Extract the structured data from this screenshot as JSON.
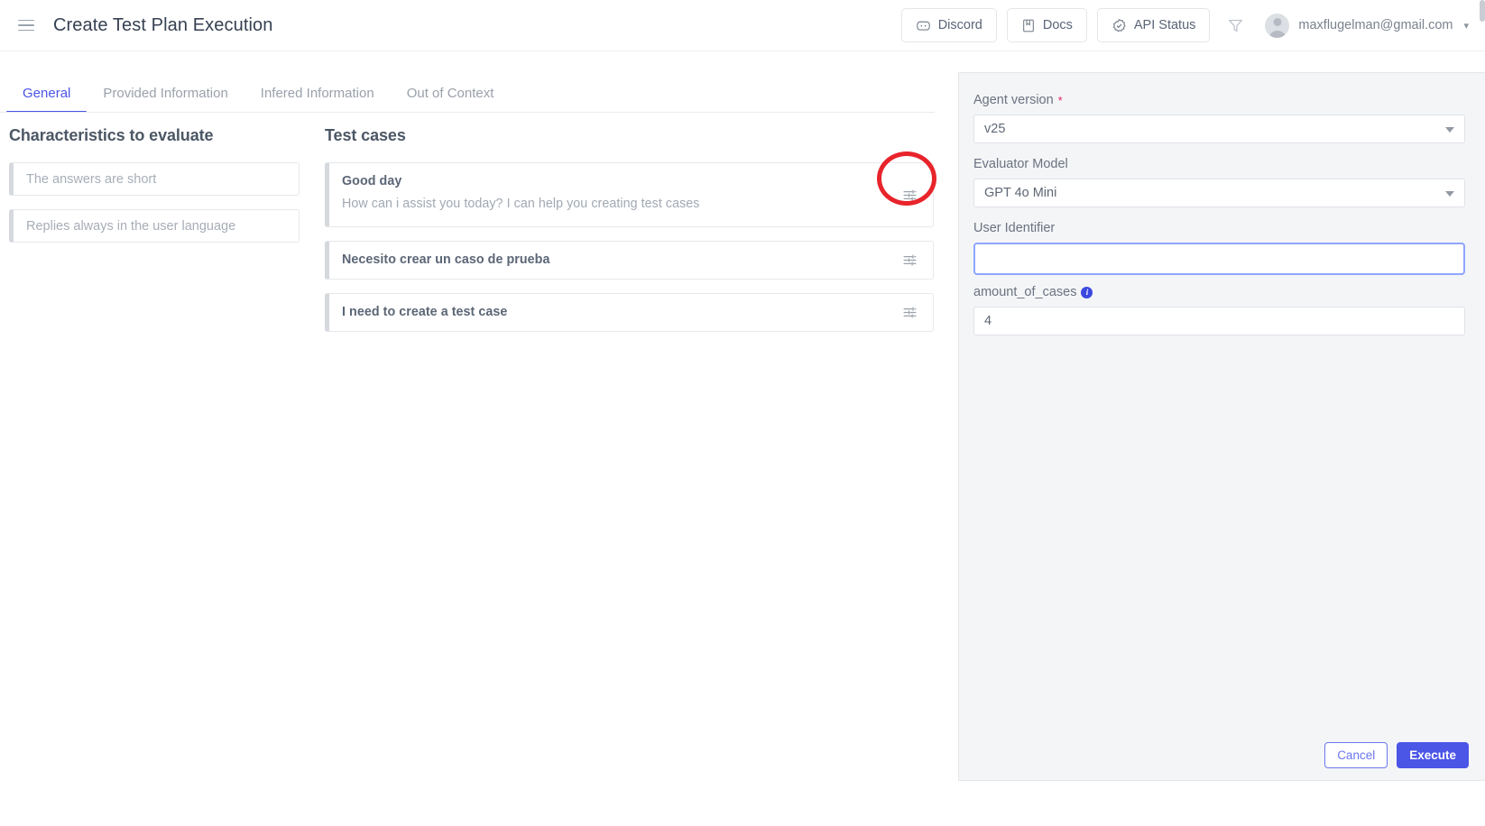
{
  "topbar": {
    "menu_icon": "hamburger-icon",
    "title": "Create Test Plan Execution",
    "buttons": [
      {
        "label": "Discord",
        "icon": "discord-icon"
      },
      {
        "label": "Docs",
        "icon": "book-icon"
      },
      {
        "label": "API Status",
        "icon": "check-badge-icon"
      }
    ],
    "filter_icon": "filter-icon",
    "user": {
      "email": "maxflugelman@gmail.com",
      "avatar_icon": "avatar-icon",
      "caret_icon": "chevron-down-icon"
    }
  },
  "tabs": [
    {
      "label": "General",
      "active": true
    },
    {
      "label": "Provided Information",
      "active": false
    },
    {
      "label": "Infered Information",
      "active": false
    },
    {
      "label": "Out of Context",
      "active": false
    }
  ],
  "characteristics": {
    "heading": "Characteristics to evaluate",
    "items": [
      {
        "text": "The answers are short"
      },
      {
        "text": "Replies always in the user language"
      }
    ]
  },
  "test_cases": {
    "heading": "Test cases",
    "items": [
      {
        "title": "Good day",
        "subtitle": "How can i assist you today? I can help you creating test cases",
        "action_icon": "tune-icon",
        "highlighted": true
      },
      {
        "title": "Necesito crear un caso de prueba",
        "subtitle": "",
        "action_icon": "tune-icon",
        "highlighted": false
      },
      {
        "title": "I need to create a test case",
        "subtitle": "",
        "action_icon": "tune-icon",
        "highlighted": false
      }
    ]
  },
  "right_panel": {
    "agent_version": {
      "label": "Agent version",
      "required_marker": "*",
      "value": "v25",
      "chevron_icon": "chevron-down-icon"
    },
    "evaluator_model": {
      "label": "Evaluator Model",
      "value": "GPT 4o Mini",
      "chevron_icon": "chevron-down-icon"
    },
    "user_identifier": {
      "label": "User Identifier",
      "value": "",
      "placeholder": ""
    },
    "amount_of_cases": {
      "label": "amount_of_cases",
      "info_icon": "info-icon",
      "info_glyph": "i",
      "value": "4"
    },
    "footer": {
      "cancel_label": "Cancel",
      "execute_label": "Execute"
    }
  },
  "annotation": {
    "shape": "red-circle-highlight",
    "color": "#e8242b"
  },
  "colors": {
    "accent": "#4b55e6",
    "panel_bg": "#f4f5f7",
    "text_muted": "#a2a9b3",
    "annotation_red": "#e8242b"
  }
}
